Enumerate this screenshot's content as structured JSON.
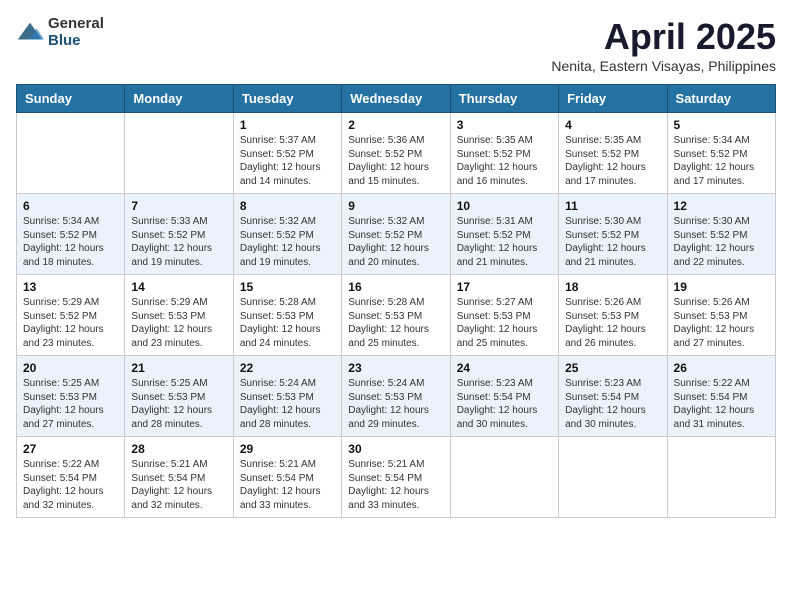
{
  "header": {
    "logo_general": "General",
    "logo_blue": "Blue",
    "month": "April 2025",
    "location": "Nenita, Eastern Visayas, Philippines"
  },
  "weekdays": [
    "Sunday",
    "Monday",
    "Tuesday",
    "Wednesday",
    "Thursday",
    "Friday",
    "Saturday"
  ],
  "rows": [
    [
      {
        "day": "",
        "sunrise": "",
        "sunset": "",
        "daylight": ""
      },
      {
        "day": "",
        "sunrise": "",
        "sunset": "",
        "daylight": ""
      },
      {
        "day": "1",
        "sunrise": "Sunrise: 5:37 AM",
        "sunset": "Sunset: 5:52 PM",
        "daylight": "Daylight: 12 hours and 14 minutes."
      },
      {
        "day": "2",
        "sunrise": "Sunrise: 5:36 AM",
        "sunset": "Sunset: 5:52 PM",
        "daylight": "Daylight: 12 hours and 15 minutes."
      },
      {
        "day": "3",
        "sunrise": "Sunrise: 5:35 AM",
        "sunset": "Sunset: 5:52 PM",
        "daylight": "Daylight: 12 hours and 16 minutes."
      },
      {
        "day": "4",
        "sunrise": "Sunrise: 5:35 AM",
        "sunset": "Sunset: 5:52 PM",
        "daylight": "Daylight: 12 hours and 17 minutes."
      },
      {
        "day": "5",
        "sunrise": "Sunrise: 5:34 AM",
        "sunset": "Sunset: 5:52 PM",
        "daylight": "Daylight: 12 hours and 17 minutes."
      }
    ],
    [
      {
        "day": "6",
        "sunrise": "Sunrise: 5:34 AM",
        "sunset": "Sunset: 5:52 PM",
        "daylight": "Daylight: 12 hours and 18 minutes."
      },
      {
        "day": "7",
        "sunrise": "Sunrise: 5:33 AM",
        "sunset": "Sunset: 5:52 PM",
        "daylight": "Daylight: 12 hours and 19 minutes."
      },
      {
        "day": "8",
        "sunrise": "Sunrise: 5:32 AM",
        "sunset": "Sunset: 5:52 PM",
        "daylight": "Daylight: 12 hours and 19 minutes."
      },
      {
        "day": "9",
        "sunrise": "Sunrise: 5:32 AM",
        "sunset": "Sunset: 5:52 PM",
        "daylight": "Daylight: 12 hours and 20 minutes."
      },
      {
        "day": "10",
        "sunrise": "Sunrise: 5:31 AM",
        "sunset": "Sunset: 5:52 PM",
        "daylight": "Daylight: 12 hours and 21 minutes."
      },
      {
        "day": "11",
        "sunrise": "Sunrise: 5:30 AM",
        "sunset": "Sunset: 5:52 PM",
        "daylight": "Daylight: 12 hours and 21 minutes."
      },
      {
        "day": "12",
        "sunrise": "Sunrise: 5:30 AM",
        "sunset": "Sunset: 5:52 PM",
        "daylight": "Daylight: 12 hours and 22 minutes."
      }
    ],
    [
      {
        "day": "13",
        "sunrise": "Sunrise: 5:29 AM",
        "sunset": "Sunset: 5:52 PM",
        "daylight": "Daylight: 12 hours and 23 minutes."
      },
      {
        "day": "14",
        "sunrise": "Sunrise: 5:29 AM",
        "sunset": "Sunset: 5:53 PM",
        "daylight": "Daylight: 12 hours and 23 minutes."
      },
      {
        "day": "15",
        "sunrise": "Sunrise: 5:28 AM",
        "sunset": "Sunset: 5:53 PM",
        "daylight": "Daylight: 12 hours and 24 minutes."
      },
      {
        "day": "16",
        "sunrise": "Sunrise: 5:28 AM",
        "sunset": "Sunset: 5:53 PM",
        "daylight": "Daylight: 12 hours and 25 minutes."
      },
      {
        "day": "17",
        "sunrise": "Sunrise: 5:27 AM",
        "sunset": "Sunset: 5:53 PM",
        "daylight": "Daylight: 12 hours and 25 minutes."
      },
      {
        "day": "18",
        "sunrise": "Sunrise: 5:26 AM",
        "sunset": "Sunset: 5:53 PM",
        "daylight": "Daylight: 12 hours and 26 minutes."
      },
      {
        "day": "19",
        "sunrise": "Sunrise: 5:26 AM",
        "sunset": "Sunset: 5:53 PM",
        "daylight": "Daylight: 12 hours and 27 minutes."
      }
    ],
    [
      {
        "day": "20",
        "sunrise": "Sunrise: 5:25 AM",
        "sunset": "Sunset: 5:53 PM",
        "daylight": "Daylight: 12 hours and 27 minutes."
      },
      {
        "day": "21",
        "sunrise": "Sunrise: 5:25 AM",
        "sunset": "Sunset: 5:53 PM",
        "daylight": "Daylight: 12 hours and 28 minutes."
      },
      {
        "day": "22",
        "sunrise": "Sunrise: 5:24 AM",
        "sunset": "Sunset: 5:53 PM",
        "daylight": "Daylight: 12 hours and 28 minutes."
      },
      {
        "day": "23",
        "sunrise": "Sunrise: 5:24 AM",
        "sunset": "Sunset: 5:53 PM",
        "daylight": "Daylight: 12 hours and 29 minutes."
      },
      {
        "day": "24",
        "sunrise": "Sunrise: 5:23 AM",
        "sunset": "Sunset: 5:54 PM",
        "daylight": "Daylight: 12 hours and 30 minutes."
      },
      {
        "day": "25",
        "sunrise": "Sunrise: 5:23 AM",
        "sunset": "Sunset: 5:54 PM",
        "daylight": "Daylight: 12 hours and 30 minutes."
      },
      {
        "day": "26",
        "sunrise": "Sunrise: 5:22 AM",
        "sunset": "Sunset: 5:54 PM",
        "daylight": "Daylight: 12 hours and 31 minutes."
      }
    ],
    [
      {
        "day": "27",
        "sunrise": "Sunrise: 5:22 AM",
        "sunset": "Sunset: 5:54 PM",
        "daylight": "Daylight: 12 hours and 32 minutes."
      },
      {
        "day": "28",
        "sunrise": "Sunrise: 5:21 AM",
        "sunset": "Sunset: 5:54 PM",
        "daylight": "Daylight: 12 hours and 32 minutes."
      },
      {
        "day": "29",
        "sunrise": "Sunrise: 5:21 AM",
        "sunset": "Sunset: 5:54 PM",
        "daylight": "Daylight: 12 hours and 33 minutes."
      },
      {
        "day": "30",
        "sunrise": "Sunrise: 5:21 AM",
        "sunset": "Sunset: 5:54 PM",
        "daylight": "Daylight: 12 hours and 33 minutes."
      },
      {
        "day": "",
        "sunrise": "",
        "sunset": "",
        "daylight": ""
      },
      {
        "day": "",
        "sunrise": "",
        "sunset": "",
        "daylight": ""
      },
      {
        "day": "",
        "sunrise": "",
        "sunset": "",
        "daylight": ""
      }
    ]
  ]
}
